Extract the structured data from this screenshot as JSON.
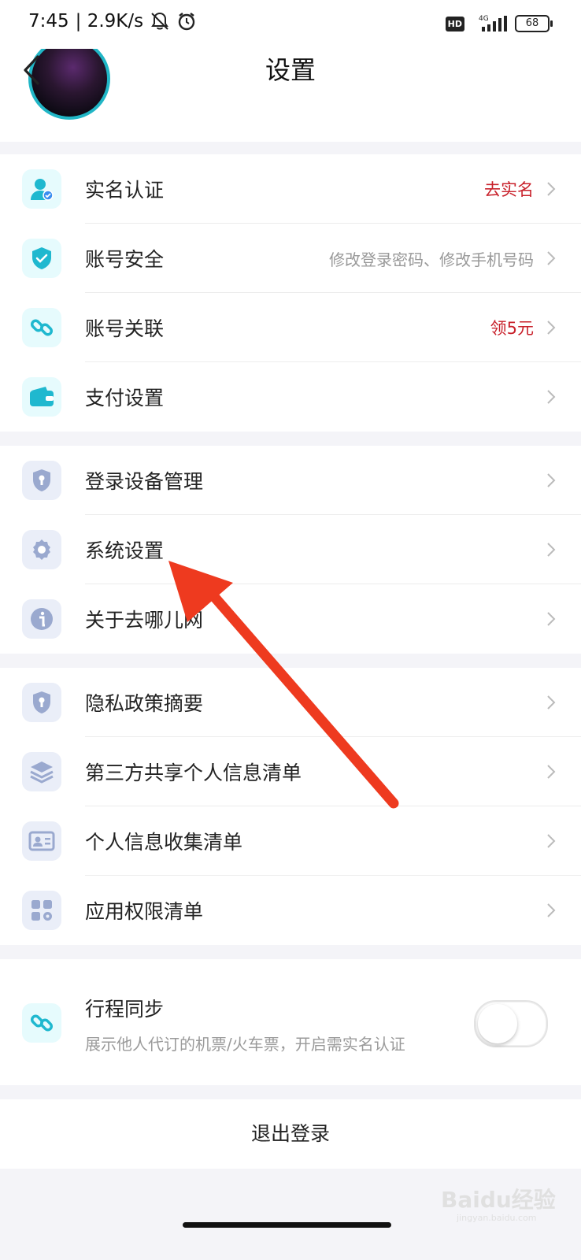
{
  "status_bar": {
    "time": "7:45",
    "speed": "| 2.9K/s",
    "hd": "HD",
    "network": "4G",
    "battery": "68"
  },
  "header": {
    "title": "设置",
    "back_icon": "chevron-left-icon"
  },
  "section1": [
    {
      "label": "实名认证",
      "value": "去实名",
      "value_color": "#c8202a",
      "icon": "user-verified-icon"
    },
    {
      "label": "账号安全",
      "value": "修改登录密码、修改手机号码",
      "value_color": "#999999",
      "icon": "shield-check-icon"
    },
    {
      "label": "账号关联",
      "value": "领5元",
      "value_color": "#c8202a",
      "icon": "link-icon"
    },
    {
      "label": "支付设置",
      "value": "",
      "icon": "wallet-icon"
    }
  ],
  "section2": [
    {
      "label": "登录设备管理",
      "icon": "shield-lock-icon"
    },
    {
      "label": "系统设置",
      "icon": "gear-icon"
    },
    {
      "label": "关于去哪儿网",
      "icon": "info-icon"
    }
  ],
  "section3": [
    {
      "label": "隐私政策摘要",
      "icon": "shield-lock-icon"
    },
    {
      "label": "第三方共享个人信息清单",
      "icon": "layers-icon"
    },
    {
      "label": "个人信息收集清单",
      "icon": "id-card-icon"
    },
    {
      "label": "应用权限清单",
      "icon": "apps-icon"
    }
  ],
  "trip_sync": {
    "title": "行程同步",
    "description": "展示他人代订的机票/火车票，开启需实名认证",
    "enabled": false
  },
  "logout": {
    "label": "退出登录"
  },
  "watermark": {
    "brand": "Baidu经验",
    "url": "jingyan.baidu.com"
  },
  "colors": {
    "accent_cyan": "#21b6c6",
    "alert_red": "#c8202a",
    "arrow_red": "#ee3a1f"
  }
}
